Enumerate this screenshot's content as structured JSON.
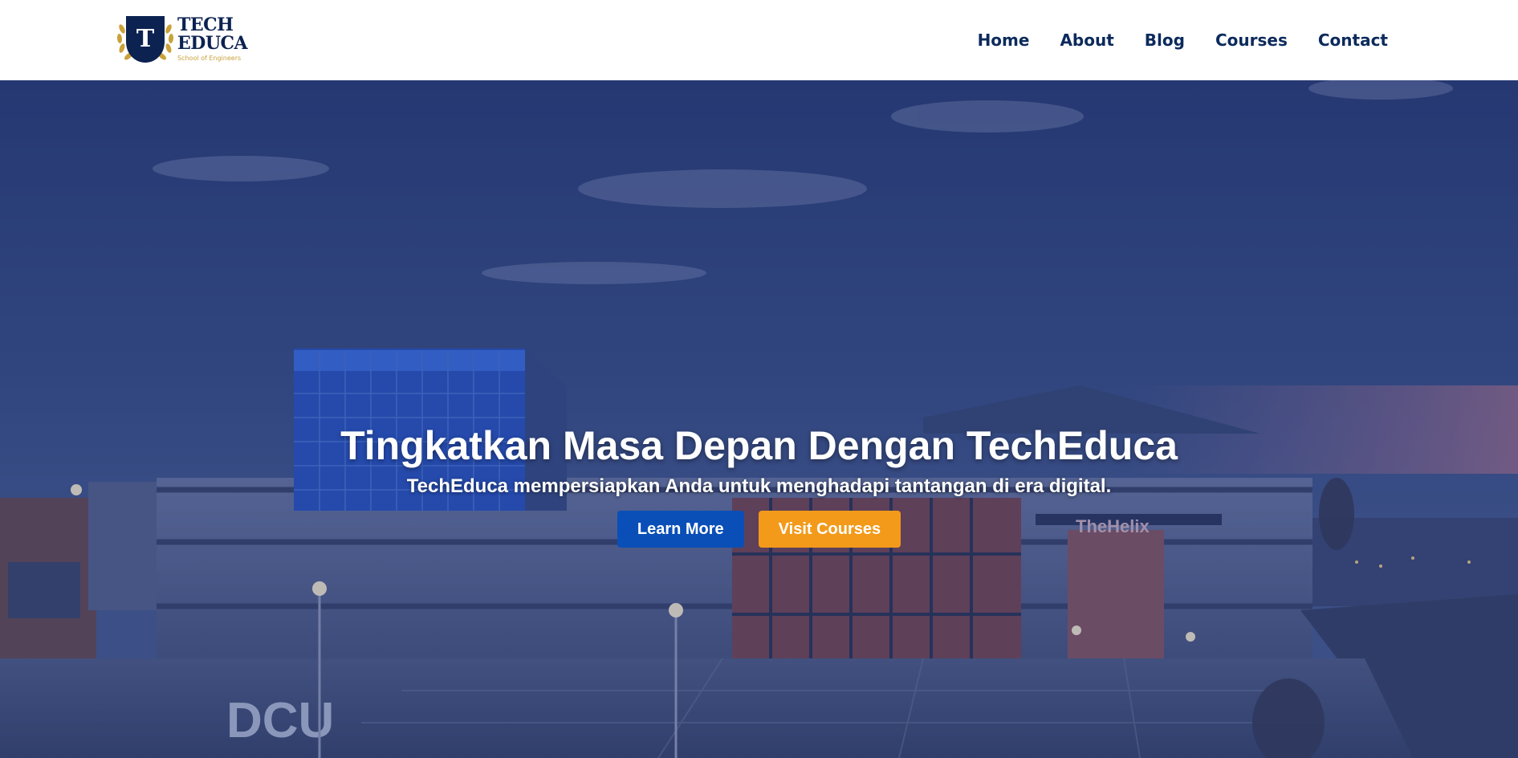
{
  "brand": {
    "emblem_letter": "T",
    "name_line1": "TECH",
    "name_line2": "EDUCA",
    "tagline": "School of Engineers"
  },
  "nav": {
    "items": [
      {
        "label": "Home"
      },
      {
        "label": "About"
      },
      {
        "label": "Blog"
      },
      {
        "label": "Courses"
      },
      {
        "label": "Contact"
      }
    ]
  },
  "hero": {
    "title": "Tingkatkan Masa Depan Dengan TechEduca",
    "subtitle": "TechEduca mempersiapkan Anda untuk menghadapi tantangan di era digital.",
    "primary_button": "Learn More",
    "secondary_button": "Visit Courses",
    "building_sign": "TheHelix",
    "campus_letters": "DCU"
  },
  "colors": {
    "nav_text": "#0c2a5c",
    "brand_navy": "#0c2250",
    "brand_gold": "#c9a23a",
    "primary_button": "#0a4fb8",
    "secondary_button": "#f39a1a"
  }
}
